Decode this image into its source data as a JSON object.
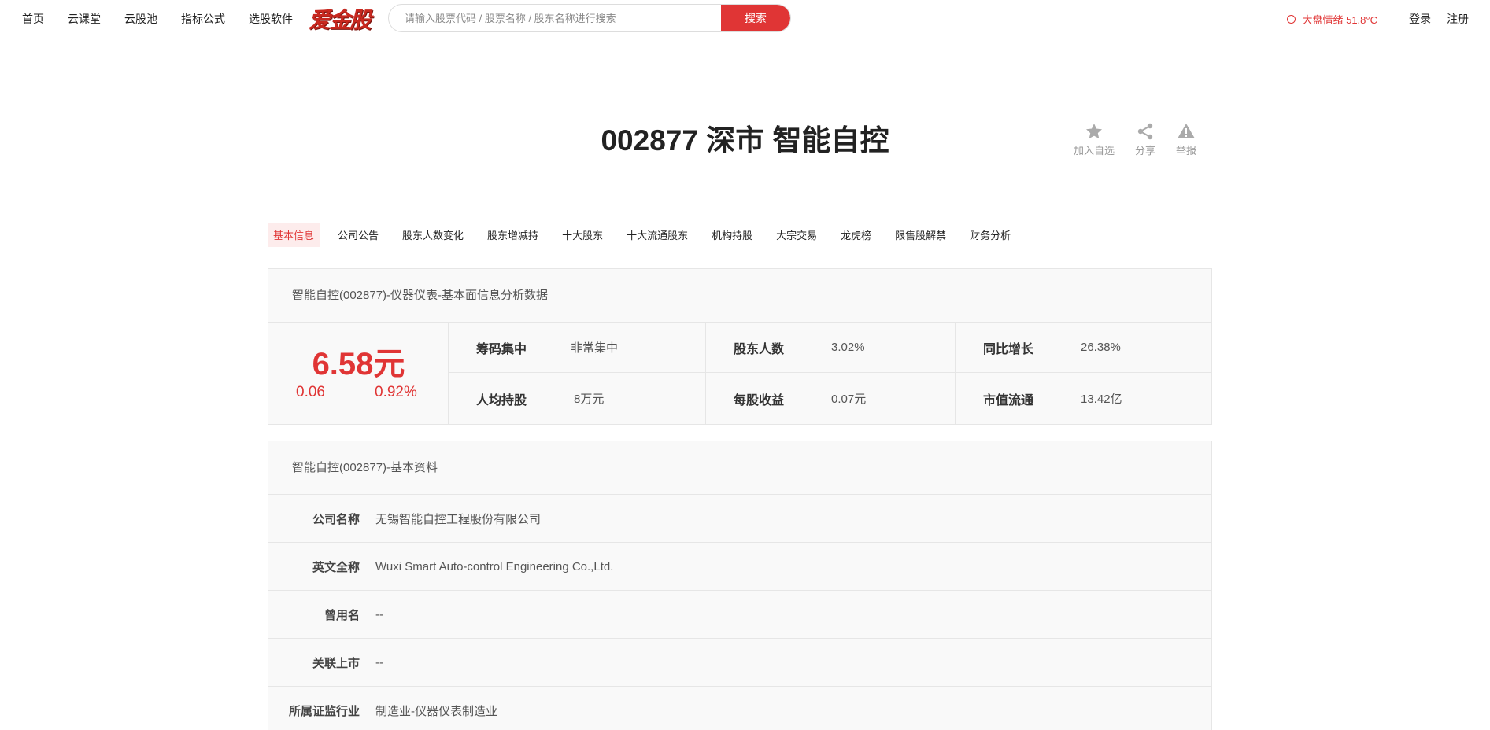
{
  "nav": {
    "links": [
      "首页",
      "云课堂",
      "云股池",
      "指标公式",
      "选股软件"
    ],
    "logo": "爱金股",
    "search_placeholder": "请输入股票代码 / 股票名称 / 股东名称进行搜索",
    "search_button": "搜索",
    "mood": "大盘情绪 51.8°C",
    "login": "登录",
    "register": "注册"
  },
  "header": {
    "title": "002877 深市 智能自控",
    "actions": [
      "加入自选",
      "分享",
      "举报"
    ]
  },
  "tabs": [
    "基本信息",
    "公司公告",
    "股东人数变化",
    "股东增减持",
    "十大股东",
    "十大流通股东",
    "机构持股",
    "大宗交易",
    "龙虎榜",
    "限售股解禁",
    "财务分析"
  ],
  "quote_panel": {
    "heading": "智能自控(002877)-仪器仪表-基本面信息分析数据",
    "price": "6.58元",
    "change": "0.06",
    "change_pct": "0.92%",
    "stats": [
      {
        "label": "筹码集中",
        "value": "非常集中"
      },
      {
        "label": "人均持股",
        "value": "8万元"
      },
      {
        "label": "股东人数",
        "value": "3.02%"
      },
      {
        "label": "每股收益",
        "value": "0.07元"
      },
      {
        "label": "同比增长",
        "value": "26.38%"
      },
      {
        "label": "市值流通",
        "value": "13.42亿"
      }
    ]
  },
  "profile_panel": {
    "heading": "智能自控(002877)-基本资料",
    "rows": [
      {
        "label": "公司名称",
        "value": "无锡智能自控工程股份有限公司"
      },
      {
        "label": "英文全称",
        "value": "Wuxi Smart Auto-control Engineering Co.,Ltd."
      },
      {
        "label": "曾用名",
        "value": "--"
      },
      {
        "label": "关联上市",
        "value": "--"
      },
      {
        "label": "所属证监行业",
        "value": "制造业-仪器仪表制造业"
      }
    ]
  },
  "colors": {
    "accent": "#e03535",
    "active_tab_bg": "#fdecec"
  }
}
